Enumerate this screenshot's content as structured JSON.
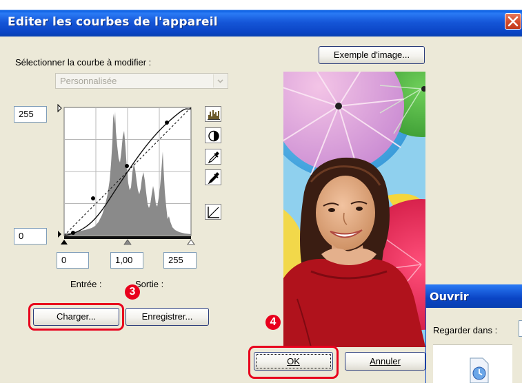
{
  "window": {
    "title": "Editer les courbes de l'appareil"
  },
  "curve_select": {
    "label": "Sélectionner la courbe à modifier :",
    "value": "Personnalisée"
  },
  "curve_editor": {
    "output_max": "255",
    "output_min": "0",
    "input_black": "0",
    "input_gamma": "1,00",
    "input_white": "255",
    "input_label": "Entrée :",
    "output_label": "Sortie :"
  },
  "buttons": {
    "sample_image": "Exemple d'image...",
    "load": "Charger...",
    "save": "Enregistrer...",
    "ok": "OK",
    "cancel": "Annuler"
  },
  "tools": [
    "histogram-icon",
    "contrast-icon",
    "white-eyedropper-icon",
    "black-eyedropper-icon",
    "reset-curve-icon"
  ],
  "annotations": {
    "step_load": "3",
    "step_ok": "4"
  },
  "open_dialog": {
    "title": "Ouvrir",
    "look_in_label": "Regarder dans :"
  },
  "colors": {
    "title_bar": "#0a44c4",
    "dialog_bg": "#ece9d8",
    "highlight": "#e8001c"
  }
}
